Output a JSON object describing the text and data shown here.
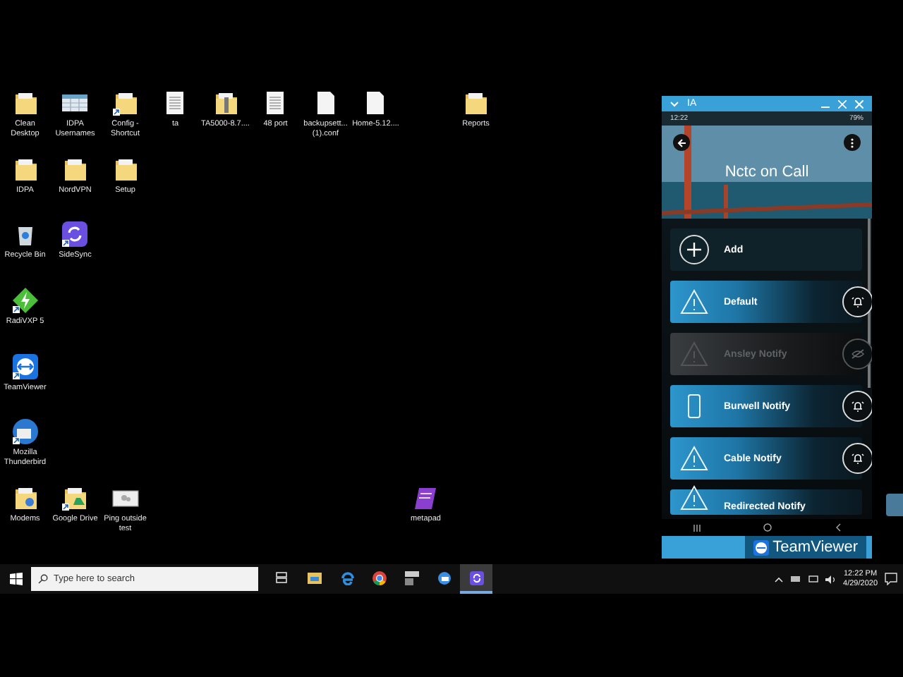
{
  "desktop": {
    "icons": [
      {
        "label": "Clean Desktop",
        "kind": "folder",
        "shortcut": false
      },
      {
        "label": "IDPA Usernames",
        "kind": "spreadsheet",
        "shortcut": false
      },
      {
        "label": "Config - Shortcut",
        "kind": "folder",
        "shortcut": true
      },
      {
        "label": "ta",
        "kind": "document",
        "shortcut": false
      },
      {
        "label": "TA5000-8.7....",
        "kind": "zip",
        "shortcut": false
      },
      {
        "label": "48 port",
        "kind": "document",
        "shortcut": false
      },
      {
        "label": "backupsett... (1).conf",
        "kind": "blank",
        "shortcut": false
      },
      {
        "label": "Home-5.12....",
        "kind": "blank",
        "shortcut": false
      },
      {
        "label": "Reports",
        "kind": "folder",
        "shortcut": false
      },
      {
        "label": "IDPA",
        "kind": "folder",
        "shortcut": false
      },
      {
        "label": "NordVPN",
        "kind": "folder",
        "shortcut": false
      },
      {
        "label": "Setup",
        "kind": "folder",
        "shortcut": false
      },
      {
        "label": "Recycle Bin",
        "kind": "recycle",
        "shortcut": false
      },
      {
        "label": "SideSync",
        "kind": "sync",
        "shortcut": true
      },
      {
        "label": "RadiVXP 5",
        "kind": "bolt",
        "shortcut": true
      },
      {
        "label": "TeamViewer",
        "kind": "teamviewer",
        "shortcut": true
      },
      {
        "label": "Mozilla Thunderbird",
        "kind": "mail",
        "shortcut": true
      },
      {
        "label": "Modems",
        "kind": "userfolder",
        "shortcut": false
      },
      {
        "label": "Google Drive",
        "kind": "drivefolder",
        "shortcut": true
      },
      {
        "label": "Ping outside test",
        "kind": "image",
        "shortcut": false
      },
      {
        "label": "metapad",
        "kind": "notepad",
        "shortcut": false
      }
    ]
  },
  "phone_window": {
    "title": "IA",
    "status_time": "12:22",
    "battery": "79%",
    "app_title": "Nctc on Call",
    "items": [
      {
        "label": "Add",
        "kind": "add",
        "disabled": false
      },
      {
        "label": "Default",
        "kind": "warning",
        "disabled": false
      },
      {
        "label": "Ansley Notify",
        "kind": "warning",
        "disabled": true
      },
      {
        "label": "Burwell Notify",
        "kind": "phone",
        "disabled": false
      },
      {
        "label": "Cable Notify",
        "kind": "warning",
        "disabled": false
      },
      {
        "label": "Redirected Notify",
        "kind": "warning",
        "disabled": false
      }
    ],
    "banner": "TeamViewer"
  },
  "taskbar": {
    "search": {
      "placeholder": "Type here to search"
    },
    "apps": [
      {
        "kind": "taskview",
        "selected": false
      },
      {
        "kind": "explorer",
        "selected": false
      },
      {
        "kind": "edge",
        "selected": false
      },
      {
        "kind": "chrome",
        "selected": false
      },
      {
        "kind": "app",
        "selected": false
      },
      {
        "kind": "outlook",
        "selected": false
      },
      {
        "kind": "sync",
        "selected": true
      }
    ],
    "time": "12:22 PM",
    "date": "4/29/2020"
  }
}
